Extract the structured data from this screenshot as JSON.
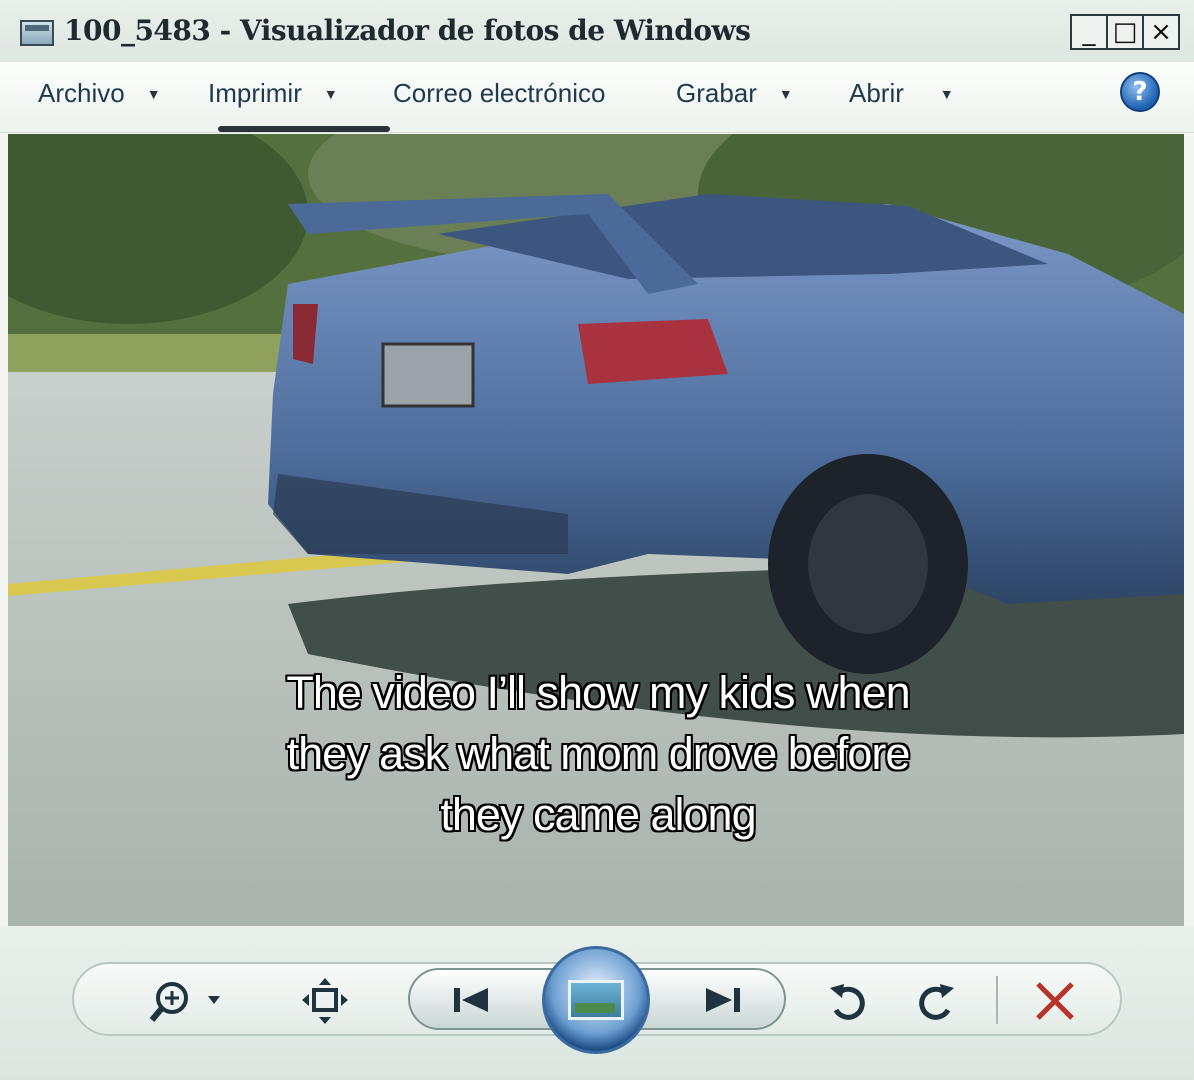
{
  "window": {
    "title": "100_5483 - Visualizador de fotos de Windows",
    "controls": {
      "minimize": "_",
      "maximize": "□",
      "close": "×"
    }
  },
  "menu": {
    "items": [
      {
        "label": "Archivo",
        "has_dropdown": true
      },
      {
        "label": "Imprimir",
        "has_dropdown": true
      },
      {
        "label": "Correo electrónico",
        "has_dropdown": false
      },
      {
        "label": "Grabar",
        "has_dropdown": true
      },
      {
        "label": "Abrir",
        "has_dropdown": true
      }
    ],
    "help_symbol": "?"
  },
  "photo": {
    "caption": "The video I’ll show my kids when they ask what mom drove before they came along"
  },
  "toolbar": {
    "icons": [
      "zoom-icon",
      "actual-size-icon",
      "previous-icon",
      "slideshow-icon",
      "next-icon",
      "rotate-counterclockwise-icon",
      "rotate-clockwise-icon",
      "delete-icon"
    ]
  },
  "colors": {
    "accent": "#1d5fb0",
    "delete": "#b8322a",
    "car": "#5c7db0"
  }
}
